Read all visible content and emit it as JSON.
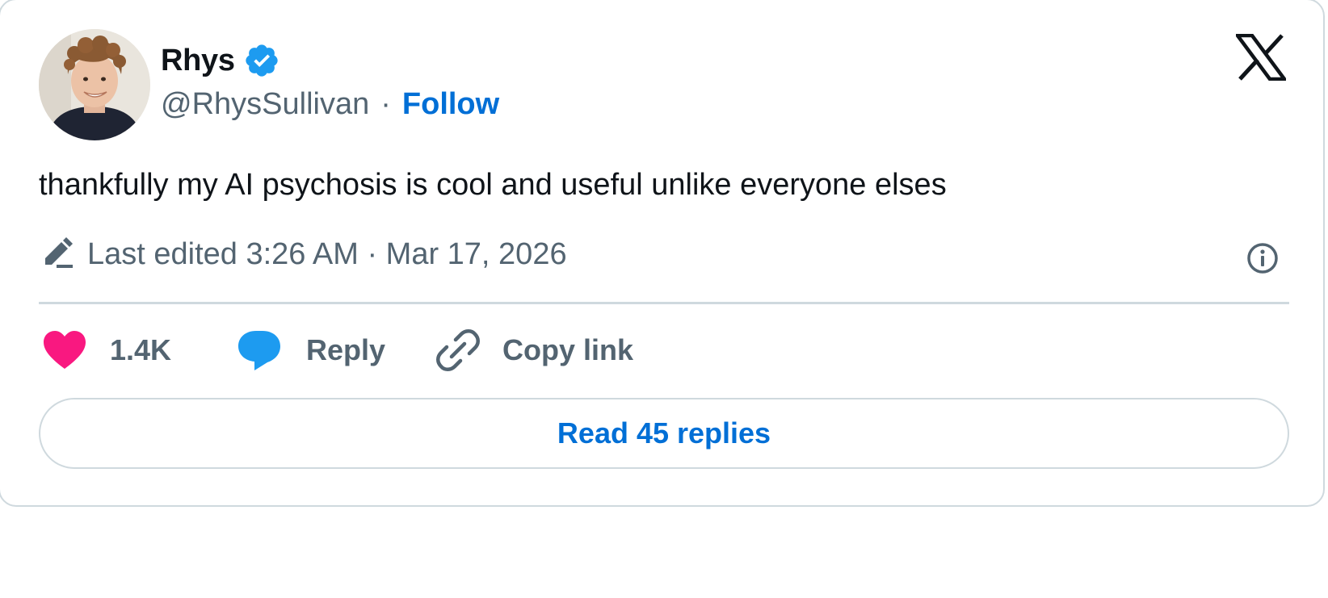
{
  "author": {
    "display_name": "Rhys",
    "handle": "@RhysSullivan",
    "separator": "·",
    "follow_label": "Follow",
    "verified": true,
    "avatar_icon": "profile-photo"
  },
  "tweet": {
    "text": "thankfully my AI psychosis is cool and useful unlike everyone elses",
    "edited_label": "Last edited 3:26 AM · Mar 17, 2026"
  },
  "actions": {
    "like_count": "1.4K",
    "reply_label": "Reply",
    "copy_link_label": "Copy link",
    "read_replies_label": "Read 45 replies"
  },
  "icons": {
    "brand": "x-logo-icon",
    "edit": "pencil-icon",
    "info": "info-icon",
    "like": "heart-icon",
    "reply": "speech-bubble-icon",
    "copy": "link-icon"
  },
  "colors": {
    "text_primary": "#0f1419",
    "text_secondary": "#536471",
    "link_blue": "#006fd6",
    "verified_blue": "#1d9bf0",
    "like_pink": "#f91880",
    "border": "#cfd9de"
  }
}
